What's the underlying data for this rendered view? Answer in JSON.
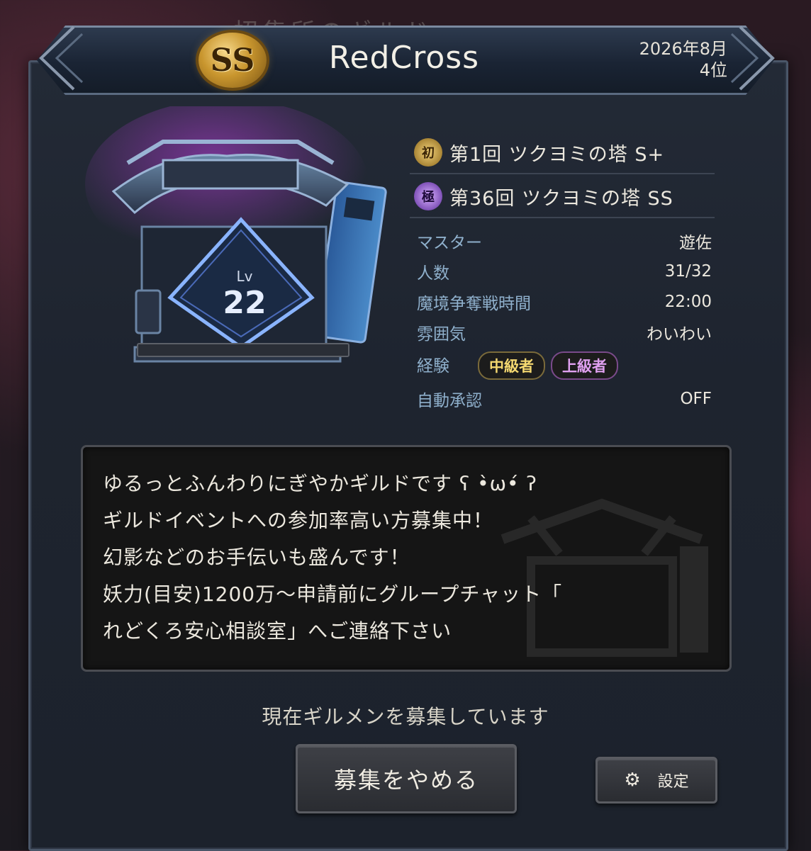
{
  "background": {
    "obscured_title": "招集所のギルド"
  },
  "header": {
    "rank_badge": "SS",
    "guild_name": "RedCross",
    "month": "2026年8月",
    "rank": "4位"
  },
  "emblem": {
    "level_label": "Lv",
    "level": "22",
    "exp_progress": 0
  },
  "towers": [
    {
      "icon": "tower-record-gold-icon",
      "text": "第1回 ツクヨミの塔 S+"
    },
    {
      "icon": "tower-record-purple-icon",
      "text": "第36回 ツクヨミの塔 SS"
    }
  ],
  "info": {
    "master_label": "マスター",
    "master_value": "遊佐",
    "members_label": "人数",
    "members_value": "31/32",
    "battle_time_label": "魔境争奪戦時間",
    "battle_time_value": "22:00",
    "atmosphere_label": "雰囲気",
    "atmosphere_value": "わいわい",
    "experience_label": "経験",
    "experience_tags": [
      "中級者",
      "上級者"
    ],
    "auto_approve_label": "自動承認",
    "auto_approve_value": "OFF"
  },
  "description": {
    "lines": [
      "ゆるっとふんわりにぎやかギルドです ʕ •̀ω•́ ʔ",
      "ギルドイベントへの参加率高い方募集中！",
      "幻影などのお手伝いも盛んです！",
      "妖力(目安)1200万〜申請前にグループチャット「",
      "れどくろ安心相談室」へご連絡下さい"
    ]
  },
  "footer": {
    "status": "現在ギルメンを募集しています",
    "stop_button": "募集をやめる",
    "settings_button": "設定"
  },
  "colors": {
    "label": "#8fb0cc",
    "tag_mid": "#f4d870",
    "tag_high": "#e0a0f0"
  }
}
